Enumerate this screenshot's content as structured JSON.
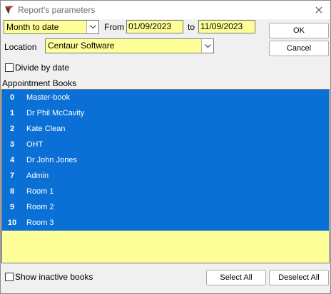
{
  "window": {
    "title": "Report's parameters"
  },
  "period": {
    "value": "Month to date"
  },
  "from": {
    "label": "From",
    "value": "01/09/2023"
  },
  "to": {
    "label": "to",
    "value": "11/09/2023"
  },
  "location": {
    "label": "Location",
    "value": "Centaur Software"
  },
  "divide_by_date": {
    "label": "Divide by date",
    "checked": false
  },
  "appointment_books": {
    "label": "Appointment Books",
    "items": [
      {
        "num": "0",
        "name": "Master-book"
      },
      {
        "num": "1",
        "name": "Dr Phil McCavity"
      },
      {
        "num": "2",
        "name": "Kate Clean"
      },
      {
        "num": "3",
        "name": "OHT"
      },
      {
        "num": "4",
        "name": "Dr John Jones"
      },
      {
        "num": "7",
        "name": "Admin"
      },
      {
        "num": "8",
        "name": "Room 1"
      },
      {
        "num": "9",
        "name": "Room 2"
      },
      {
        "num": "10",
        "name": "Room 3"
      }
    ]
  },
  "show_inactive": {
    "label": "Show inactive books",
    "checked": false
  },
  "buttons": {
    "ok": "OK",
    "cancel": "Cancel",
    "select_all": "Select All",
    "deselect_all": "Deselect All"
  },
  "colors": {
    "field_bg": "#ffff99",
    "selection": "#0a70d6"
  },
  "icons": {
    "app": "app-logo-icon",
    "close": "close-icon",
    "dropdown": "chevron-down-icon"
  }
}
